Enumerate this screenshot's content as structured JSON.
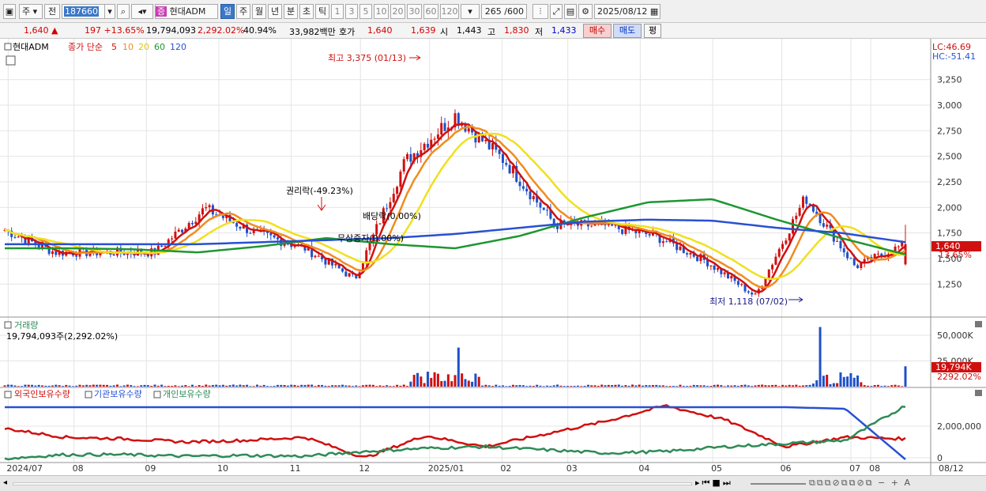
{
  "toolbar": {
    "market_type": "주",
    "range": "전",
    "code": "187660",
    "stock_badge": "증",
    "stock_name": "현대ADM",
    "periods": [
      "일",
      "주",
      "월",
      "년",
      "분",
      "초",
      "틱"
    ],
    "active_period": "일",
    "intervals": [
      "1",
      "3",
      "5",
      "10",
      "20",
      "30",
      "60",
      "120"
    ],
    "count_display": "265 /600",
    "date": "2025/08/12"
  },
  "quote": {
    "price": "1,640",
    "change_arrow": "▲",
    "change": "197",
    "change_pct": "+13.65%",
    "volume": "19,794,093",
    "volume_ratio": "2,292.02%",
    "turnover_pct": "40.94%",
    "trade_value": "33,982백만",
    "hoga_label": "호가",
    "ask": "1,640",
    "bid": "1,639",
    "open_label": "시",
    "open": "1,443",
    "high_label": "고",
    "high": "1,830",
    "low_label": "저",
    "low": "1,433",
    "buy_btn": "매수",
    "sell_btn": "매도",
    "eval_btn": "평"
  },
  "price_panel": {
    "stock_label": "현대ADM",
    "ma_title": "종가 단순",
    "ma_periods": [
      "5",
      "10",
      "20",
      "60",
      "120"
    ],
    "ma_colors": [
      "#d01010",
      "#f08c1e",
      "#f0e01e",
      "#1e9632",
      "#2850d2"
    ],
    "lc_label": "LC:46.69",
    "hc_label": "HC:-51.41",
    "current_price_label": "1,640",
    "current_change_label": "13.65%",
    "annotations": {
      "high_label": "최고 3,375 (01/13)",
      "low_label": "최저 1,118 (07/02)",
      "rights_label": "권리락(-49.23%)",
      "dividend_label": "배당락(0.00%)",
      "bonus_label": "무상증자(0.00%)"
    }
  },
  "volume_panel": {
    "title": "거래량",
    "value_label": "19,794,093주(2,292.02%)",
    "current_label": "19,794K",
    "current_ratio": "2292.02%"
  },
  "holdings_panel": {
    "series_names": [
      "외국인보유수량",
      "기관보유수량",
      "개인보유수량"
    ],
    "series_colors": [
      "#d01010",
      "#2850d2",
      "#2e8b57"
    ]
  },
  "x_axis_labels": [
    "2024/07",
    "08",
    "09",
    "10",
    "11",
    "12",
    "2025/01",
    "02",
    "03",
    "04",
    "05",
    "06",
    "07",
    "08",
    "08/12"
  ],
  "chart_data": [
    {
      "type": "line",
      "panel": "price",
      "y_ticks": [
        1250,
        1500,
        1750,
        2000,
        2250,
        2500,
        2750,
        3000,
        3250
      ],
      "ylim": [
        1020,
        3480
      ],
      "max_point": {
        "date": "2025/01/13",
        "value": 3375
      },
      "min_point": {
        "date": "2025/07/02",
        "value": 1118
      },
      "last": {
        "date": "2025/08/12",
        "open": 1443,
        "high": 1830,
        "low": 1433,
        "close": 1640
      },
      "close_series": {
        "name": "",
        "x": [
          "2024/07",
          "2024/08",
          "2024/09",
          "2024/10",
          "2024/10-mid",
          "2024/11",
          "2024/12",
          "2024/12-late",
          "2025/01",
          "2025/01-mid",
          "2025/02",
          "2025/03",
          "2025/04",
          "2025/05",
          "2025/06",
          "2025/07",
          "2025/07-mid",
          "2025/08",
          "2025/08/12"
        ],
        "values": [
          1780,
          1560,
          1560,
          1560,
          1990,
          1750,
          1600,
          1300,
          2450,
          2900,
          2450,
          1830,
          1820,
          1720,
          1480,
          1130,
          2100,
          1420,
          1640
        ]
      },
      "ma120": {
        "name": "",
        "values": [
          1640,
          1640,
          1640,
          1640,
          1660,
          1680,
          1700,
          1740,
          1800,
          1860,
          1880,
          1870,
          1800,
          1750,
          1660
        ]
      },
      "ma60": {
        "name": "",
        "values": [
          1600,
          1600,
          1590,
          1560,
          1620,
          1700,
          1640,
          1600,
          1720,
          1900,
          2050,
          2080,
          1880,
          1700,
          1540
        ]
      }
    },
    {
      "type": "bar",
      "panel": "volume",
      "y_ticks": [
        25000,
        50000
      ],
      "y_unit": "K",
      "ylim": [
        0,
        60000
      ],
      "last_value_k": 19794
    },
    {
      "type": "line",
      "panel": "holdings",
      "y_ticks": [
        0,
        2000000
      ],
      "ylim": [
        -200000,
        3600000
      ],
      "series": [
        {
          "name": "외국인보유수량",
          "values": [
            1850000,
            1300000,
            1200000,
            1000000,
            1100000,
            1300000,
            0,
            1400000,
            700000,
            1500000,
            2300000,
            3300000,
            2400000,
            700000,
            1300000,
            1200000
          ]
        },
        {
          "name": "기관보유수량",
          "values": [
            3200000,
            3200000,
            3200000,
            3200000,
            3200000,
            3200000,
            3200000,
            3200000,
            3200000,
            3200000,
            3200000,
            3200000,
            3200000,
            3200000,
            3100000,
            -100000
          ]
        },
        {
          "name": "개인보유수량",
          "values": [
            -50000,
            200000,
            200000,
            100000,
            150000,
            100000,
            400000,
            600000,
            700000,
            500000,
            300000,
            400000,
            700000,
            900000,
            1100000,
            3300000
          ]
        }
      ]
    }
  ]
}
